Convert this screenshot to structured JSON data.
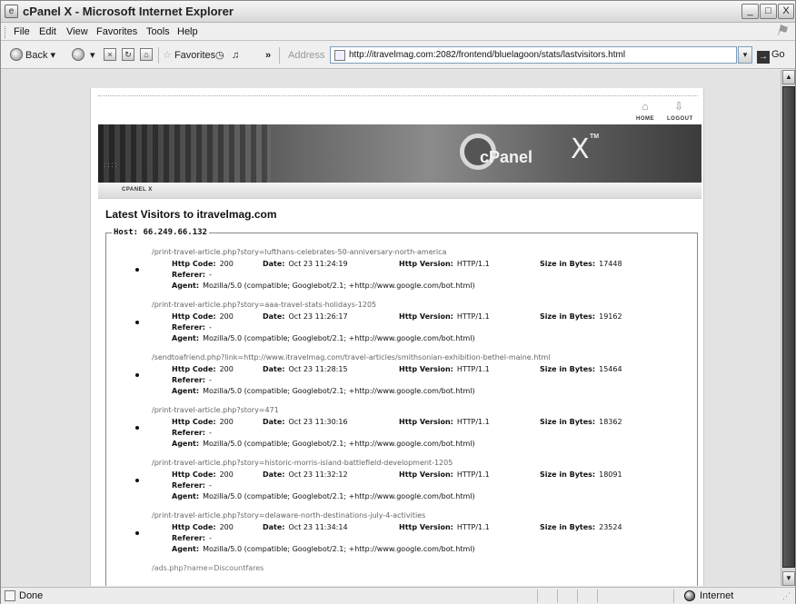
{
  "window": {
    "title": "cPanel X - Microsoft Internet Explorer",
    "buttons": {
      "minimize": "_",
      "maximize": "□",
      "close": "X"
    }
  },
  "menu": [
    "File",
    "Edit",
    "View",
    "Favorites",
    "Tools",
    "Help"
  ],
  "toolbar": {
    "back": "Back",
    "favorites": "Favorites",
    "chevron": "»",
    "address_label": "Address",
    "address_url": "http://itravelmag.com:2082/frontend/bluelagoon/stats/lastvisitors.html",
    "go": "Go"
  },
  "cpanel": {
    "home_label": "HOME",
    "logout_label": "LOGOUT",
    "logo_word": "cPanel",
    "logo_x": "X",
    "logo_tm": "TM",
    "breadcrumb": "CPANEL X",
    "page_title": "Latest Visitors to itravelmag.com",
    "host_legend": "Host: 66.249.66.132",
    "field_labels": {
      "code": "Http Code:",
      "date": "Date:",
      "version": "Http Version:",
      "size": "Size in Bytes:",
      "referer": "Referer:",
      "agent": "Agent:"
    },
    "visits": [
      {
        "url": "/print-travel-article.php?story=lufthans-celebrates-50-anniversary-north-america",
        "code": "200",
        "date": "Oct 23 11:24:19",
        "version": "HTTP/1.1",
        "size": "17448",
        "referer": "-",
        "agent": "Mozilla/5.0 (compatible; Googlebot/2.1; +http://www.google.com/bot.html)"
      },
      {
        "url": "/print-travel-article.php?story=aaa-travel-stats-holidays-1205",
        "code": "200",
        "date": "Oct 23 11:26:17",
        "version": "HTTP/1.1",
        "size": "19162",
        "referer": "-",
        "agent": "Mozilla/5.0 (compatible; Googlebot/2.1; +http://www.google.com/bot.html)"
      },
      {
        "url": "/sendtoafriend.php?link=http://www.itravelmag.com/travel-articles/smithsonian-exhibition-bethel-maine.html",
        "code": "200",
        "date": "Oct 23 11:28:15",
        "version": "HTTP/1.1",
        "size": "15464",
        "referer": "-",
        "agent": "Mozilla/5.0 (compatible; Googlebot/2.1; +http://www.google.com/bot.html)"
      },
      {
        "url": "/print-travel-article.php?story=471",
        "code": "200",
        "date": "Oct 23 11:30:16",
        "version": "HTTP/1.1",
        "size": "18362",
        "referer": "-",
        "agent": "Mozilla/5.0 (compatible; Googlebot/2.1; +http://www.google.com/bot.html)"
      },
      {
        "url": "/print-travel-article.php?story=historic-morris-island-battlefield-development-1205",
        "code": "200",
        "date": "Oct 23 11:32:12",
        "version": "HTTP/1.1",
        "size": "18091",
        "referer": "-",
        "agent": "Mozilla/5.0 (compatible; Googlebot/2.1; +http://www.google.com/bot.html)"
      },
      {
        "url": "/print-travel-article.php?story=delaware-north-destinations-july-4-activities",
        "code": "200",
        "date": "Oct 23 11:34:14",
        "version": "HTTP/1.1",
        "size": "23524",
        "referer": "-",
        "agent": "Mozilla/5.0 (compatible; Googlebot/2.1; +http://www.google.com/bot.html)"
      }
    ],
    "cutoff_url": "/ads.php?name=Discountfares"
  },
  "status": {
    "text": "Done",
    "zone": "Internet"
  }
}
